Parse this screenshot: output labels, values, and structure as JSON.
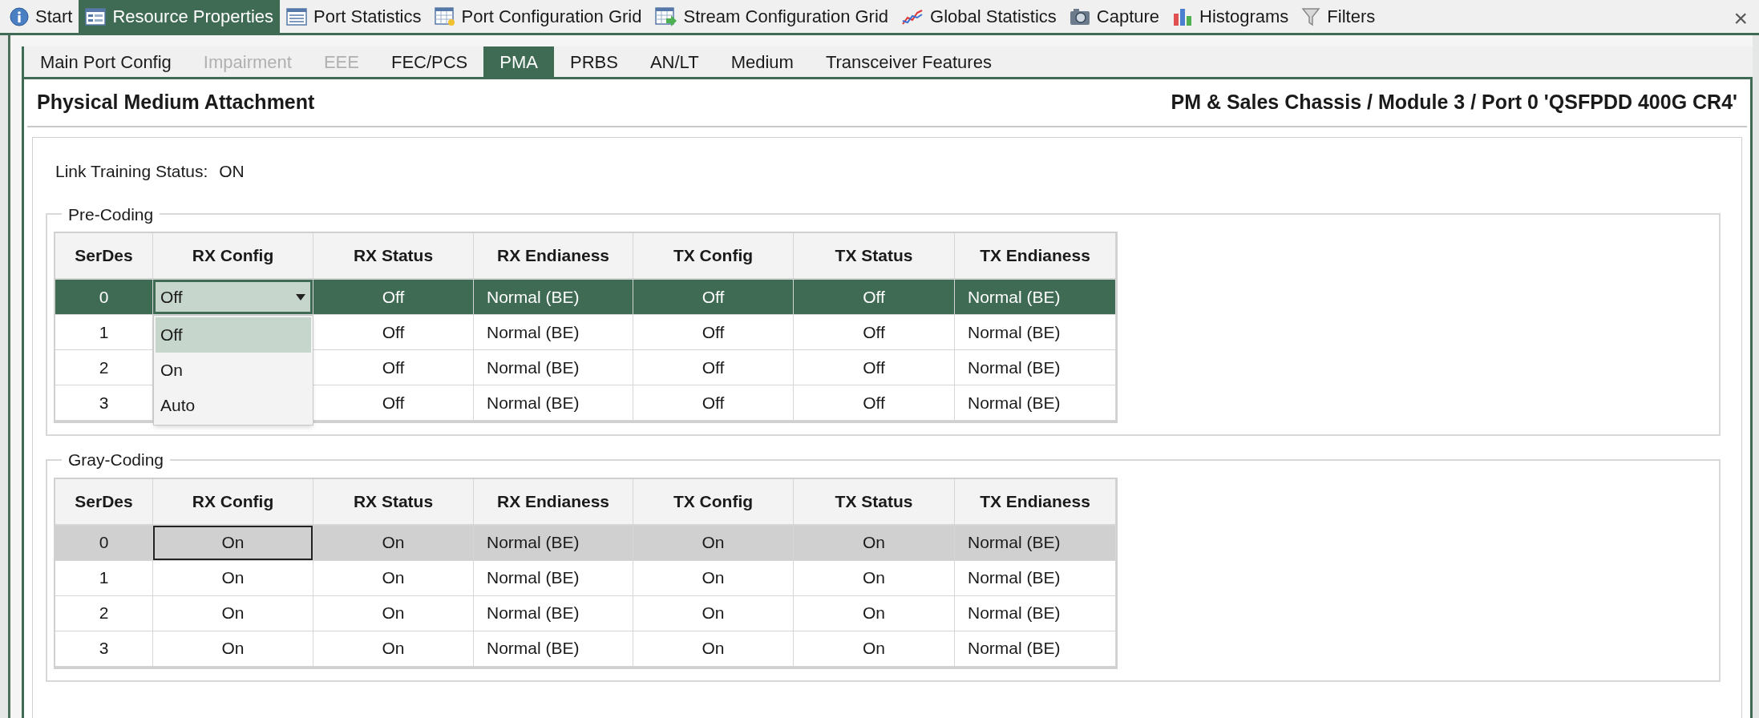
{
  "top_tabs": [
    {
      "label": "Start",
      "kind": "info",
      "selected": false
    },
    {
      "label": "Resource Properties",
      "kind": "properties",
      "selected": true
    },
    {
      "label": "Port Statistics",
      "kind": "list",
      "selected": false
    },
    {
      "label": "Port Configuration Grid",
      "kind": "grid",
      "selected": false
    },
    {
      "label": "Stream Configuration Grid",
      "kind": "grid-arrow",
      "selected": false
    },
    {
      "label": "Global Statistics",
      "kind": "line-chart",
      "selected": false
    },
    {
      "label": "Capture",
      "kind": "camera",
      "selected": false
    },
    {
      "label": "Histograms",
      "kind": "bar-chart",
      "selected": false
    },
    {
      "label": "Filters",
      "kind": "funnel",
      "selected": false
    }
  ],
  "close_button": "×",
  "sub_tabs": [
    {
      "label": "Main Port Config",
      "selected": false,
      "disabled": false
    },
    {
      "label": "Impairment",
      "selected": false,
      "disabled": true
    },
    {
      "label": "EEE",
      "selected": false,
      "disabled": true
    },
    {
      "label": "FEC/PCS",
      "selected": false,
      "disabled": false
    },
    {
      "label": "PMA",
      "selected": true,
      "disabled": false
    },
    {
      "label": "PRBS",
      "selected": false,
      "disabled": false
    },
    {
      "label": "AN/LT",
      "selected": false,
      "disabled": false
    },
    {
      "label": "Medium",
      "selected": false,
      "disabled": false
    },
    {
      "label": "Transceiver Features",
      "selected": false,
      "disabled": false
    }
  ],
  "page_title": "Physical Medium Attachment",
  "port_path": "PM & Sales Chassis / Module 3 / Port 0 'QSFPDD 400G CR4'",
  "link_training": {
    "label": "Link Training Status:",
    "value": "ON"
  },
  "sections": [
    {
      "title": "Pre-Coding",
      "active": true,
      "columns": [
        "SerDes",
        "RX Config",
        "RX Status",
        "RX Endianess",
        "TX Config",
        "TX Status",
        "TX Endianess"
      ],
      "rows": [
        {
          "selected": true,
          "cells": [
            "0",
            {
              "text": "Off",
              "kind": "combo",
              "expanded": true,
              "options": [
                {
                  "label": "Off",
                  "selected": true
                },
                {
                  "label": "On",
                  "selected": false
                },
                {
                  "label": "Auto",
                  "selected": false
                }
              ]
            },
            "Off",
            "Normal (BE)",
            "Off",
            "Off",
            "Normal (BE)"
          ]
        },
        {
          "selected": false,
          "cells": [
            "1",
            null,
            "Off",
            "Normal (BE)",
            "Off",
            "Off",
            "Normal (BE)"
          ]
        },
        {
          "selected": false,
          "cells": [
            "2",
            null,
            "Off",
            "Normal (BE)",
            "Off",
            "Off",
            "Normal (BE)"
          ]
        },
        {
          "selected": false,
          "cells": [
            "3",
            null,
            "Off",
            "Normal (BE)",
            "Off",
            "Off",
            "Normal (BE)"
          ]
        }
      ]
    },
    {
      "title": "Gray-Coding",
      "active": false,
      "columns": [
        "SerDes",
        "RX Config",
        "RX Status",
        "RX Endianess",
        "TX Config",
        "TX Status",
        "TX Endianess"
      ],
      "rows": [
        {
          "selected": true,
          "cells": [
            "0",
            {
              "text": "On",
              "kind": "focused"
            },
            "On",
            "Normal (BE)",
            "On",
            "On",
            "Normal (BE)"
          ]
        },
        {
          "selected": false,
          "cells": [
            "1",
            "On",
            "On",
            "Normal (BE)",
            "On",
            "On",
            "Normal (BE)"
          ]
        },
        {
          "selected": false,
          "cells": [
            "2",
            "On",
            "On",
            "Normal (BE)",
            "On",
            "On",
            "Normal (BE)"
          ]
        },
        {
          "selected": false,
          "cells": [
            "3",
            "On",
            "On",
            "Normal (BE)",
            "On",
            "On",
            "Normal (BE)"
          ]
        }
      ]
    }
  ]
}
